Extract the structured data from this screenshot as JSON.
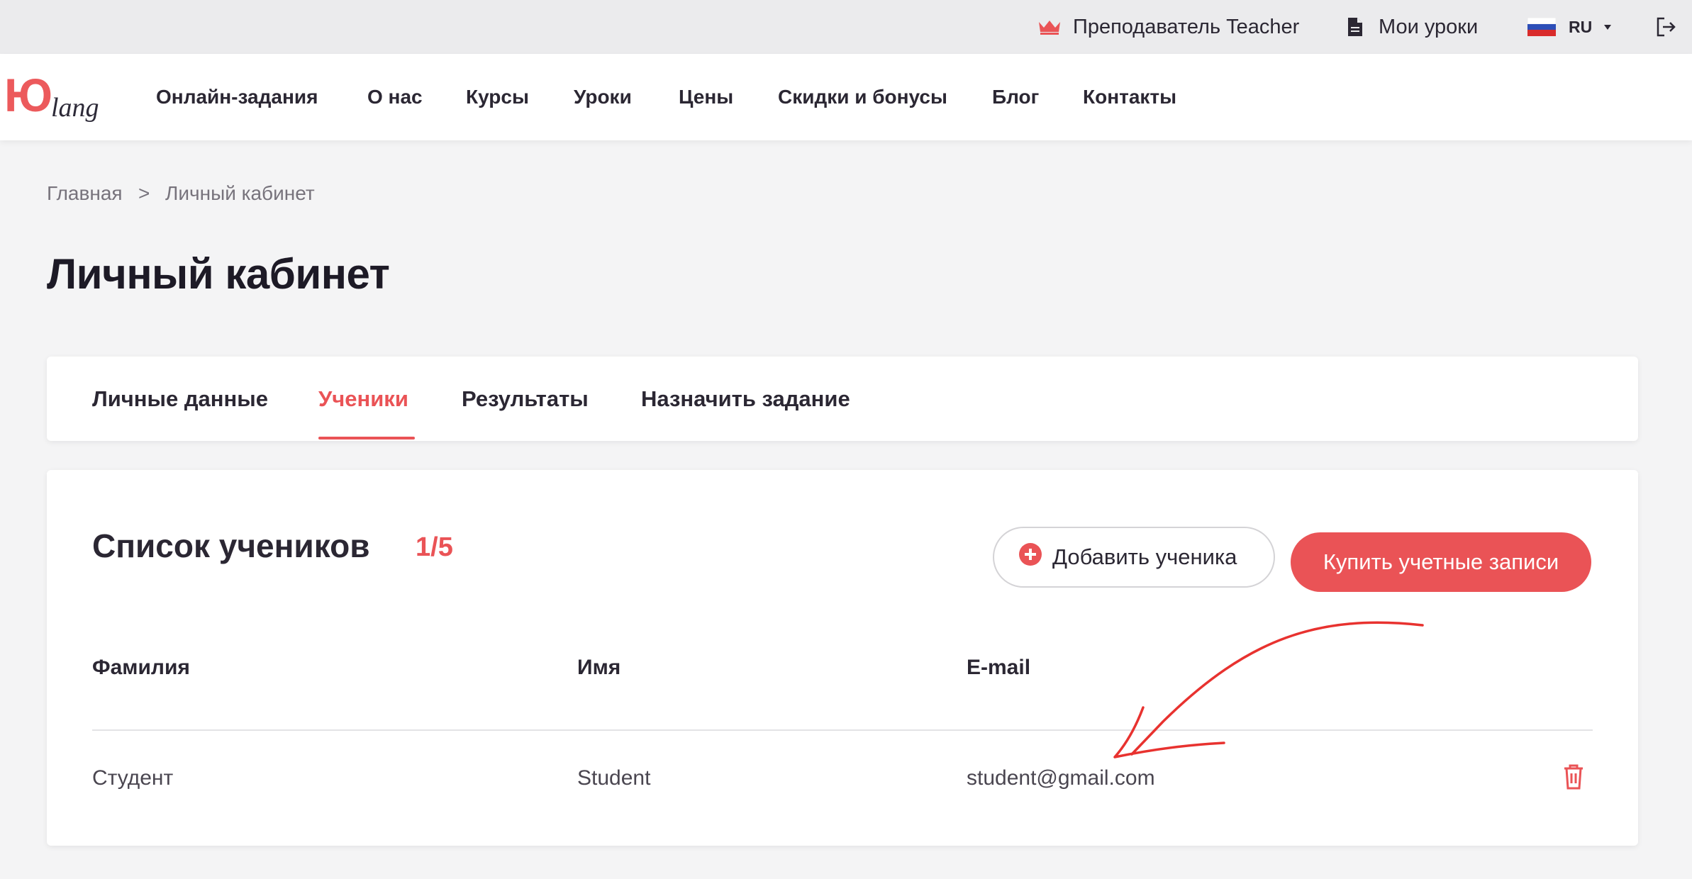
{
  "topbar": {
    "teacher_label": "Преподаватель Teacher",
    "lessons_label": "Мои уроки",
    "language": "RU"
  },
  "logo": {
    "main": "Ю",
    "sub": "lang"
  },
  "nav": {
    "items": [
      "Онлайн-задания",
      "О нас",
      "Курсы",
      "Уроки",
      "Цены",
      "Скидки и бонусы",
      "Блог",
      "Контакты"
    ]
  },
  "breadcrumb": {
    "home": "Главная",
    "separator": ">",
    "current": "Личный кабинет"
  },
  "page": {
    "title": "Личный кабинет"
  },
  "tabs": {
    "items": [
      "Личные данные",
      "Ученики",
      "Результаты",
      "Назначить задание"
    ],
    "active": "Ученики"
  },
  "students": {
    "title": "Список учеников",
    "count": "1/5",
    "add_button": "Добавить ученика",
    "buy_button": "Купить учетные записи",
    "columns": [
      "Фамилия",
      "Имя",
      "E-mail"
    ],
    "rows": [
      {
        "last_name": "Студент",
        "first_name": "Student",
        "email": "student@gmail.com"
      }
    ]
  },
  "colors": {
    "accent": "#ea5356",
    "text": "#2b2733",
    "background": "#f4f4f5"
  },
  "icons": {
    "teacher": "crown-icon",
    "lessons": "document-icon",
    "language": "flag-ru-icon",
    "logout": "logout-icon",
    "add": "plus-circle-icon",
    "delete": "trash-icon"
  }
}
